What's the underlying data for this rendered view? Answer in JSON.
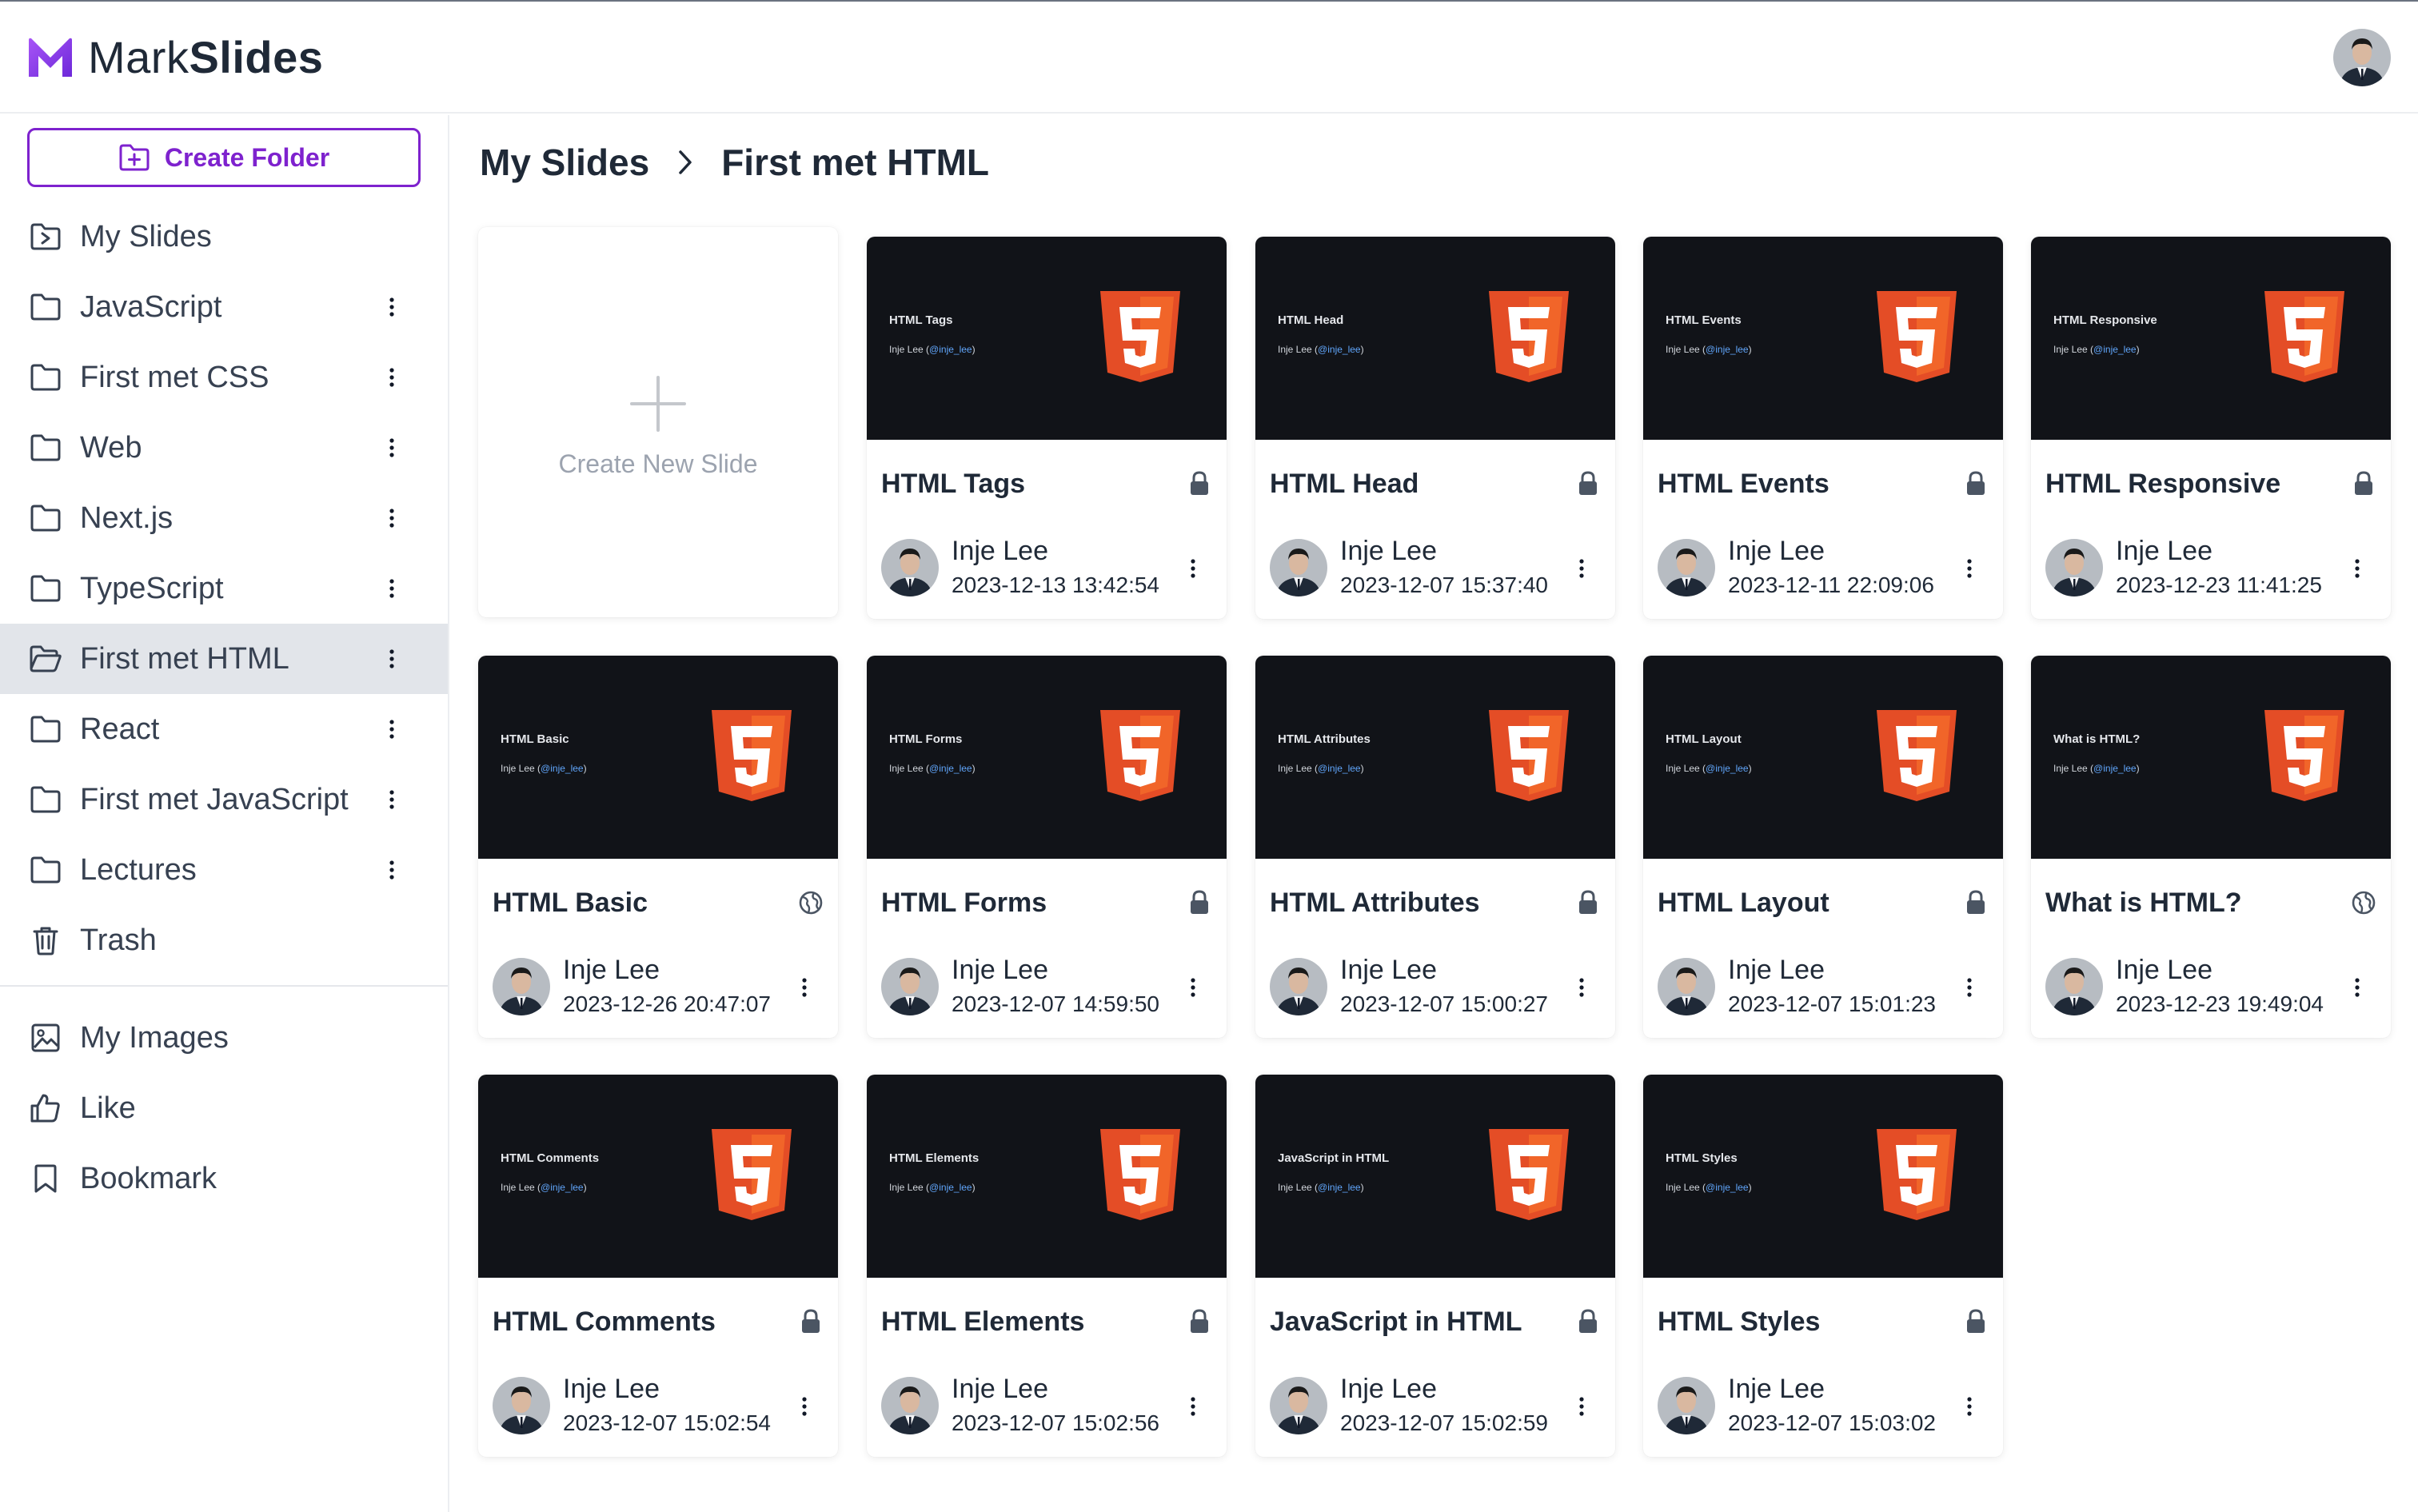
{
  "app": {
    "brand_light": "Mark",
    "brand_bold": "Slides",
    "accent": "#7e22ce"
  },
  "sidebar": {
    "create_folder_label": "Create Folder",
    "items": [
      {
        "label": "My Slides",
        "icon": "folder-user-icon",
        "menu": false
      },
      {
        "label": "JavaScript",
        "icon": "folder-icon",
        "menu": true
      },
      {
        "label": "First met CSS",
        "icon": "folder-icon",
        "menu": true
      },
      {
        "label": "Web",
        "icon": "folder-icon",
        "menu": true
      },
      {
        "label": "Next.js",
        "icon": "folder-icon",
        "menu": true
      },
      {
        "label": "TypeScript",
        "icon": "folder-icon",
        "menu": true
      },
      {
        "label": "First met HTML",
        "icon": "folder-open-icon",
        "menu": true,
        "active": true
      },
      {
        "label": "React",
        "icon": "folder-icon",
        "menu": true
      },
      {
        "label": "First met JavaScript",
        "icon": "folder-icon",
        "menu": true
      },
      {
        "label": "Lectures",
        "icon": "folder-icon",
        "menu": true
      },
      {
        "label": "Trash",
        "icon": "trash-icon",
        "menu": false
      }
    ],
    "secondary": [
      {
        "label": "My Images",
        "icon": "image-icon"
      },
      {
        "label": "Like",
        "icon": "thumbs-up-icon"
      },
      {
        "label": "Bookmark",
        "icon": "bookmark-icon"
      }
    ]
  },
  "breadcrumb": {
    "root": "My Slides",
    "current": "First met HTML"
  },
  "new_slide_label": "Create New Slide",
  "slides": [
    {
      "title": "HTML Tags",
      "thumb_title": "HTML Tags",
      "author": "Inje Lee",
      "date": "2023-12-13 13:42:54",
      "visibility": "lock-icon"
    },
    {
      "title": "HTML Head",
      "thumb_title": "HTML Head",
      "author": "Inje Lee",
      "date": "2023-12-07 15:37:40",
      "visibility": "lock-icon"
    },
    {
      "title": "HTML Events",
      "thumb_title": "HTML Events",
      "author": "Inje Lee",
      "date": "2023-12-11 22:09:06",
      "visibility": "lock-icon"
    },
    {
      "title": "HTML Responsive",
      "thumb_title": "HTML Responsive",
      "author": "Inje Lee",
      "date": "2023-12-23 11:41:25",
      "visibility": "lock-icon"
    },
    {
      "title": "HTML Basic",
      "thumb_title": "HTML Basic",
      "author": "Inje Lee",
      "date": "2023-12-26 20:47:07",
      "visibility": "globe-icon"
    },
    {
      "title": "HTML Forms",
      "thumb_title": "HTML Forms",
      "author": "Inje Lee",
      "date": "2023-12-07 14:59:50",
      "visibility": "lock-icon"
    },
    {
      "title": "HTML Attributes",
      "thumb_title": "HTML Attributes",
      "author": "Inje Lee",
      "date": "2023-12-07 15:00:27",
      "visibility": "lock-icon"
    },
    {
      "title": "HTML Layout",
      "thumb_title": "HTML Layout",
      "author": "Inje Lee",
      "date": "2023-12-07 15:01:23",
      "visibility": "lock-icon"
    },
    {
      "title": "What is HTML?",
      "thumb_title": "What is HTML?",
      "author": "Inje Lee",
      "date": "2023-12-23 19:49:04",
      "visibility": "globe-icon"
    },
    {
      "title": "HTML Comments",
      "thumb_title": "HTML Comments",
      "author": "Inje Lee",
      "date": "2023-12-07 15:02:54",
      "visibility": "lock-icon"
    },
    {
      "title": "HTML Elements",
      "thumb_title": "HTML Elements",
      "author": "Inje Lee",
      "date": "2023-12-07 15:02:56",
      "visibility": "lock-icon"
    },
    {
      "title": "JavaScript in HTML",
      "thumb_title": "JavaScript in HTML",
      "author": "Inje Lee",
      "date": "2023-12-07 15:02:59",
      "visibility": "lock-icon"
    },
    {
      "title": "HTML Styles",
      "thumb_title": "HTML Styles",
      "author": "Inje Lee",
      "date": "2023-12-07 15:03:02",
      "visibility": "lock-icon"
    }
  ],
  "thumb_author_prefix": "Inje Lee (",
  "thumb_author_handle": "@inje_lee",
  "thumb_author_suffix": ")"
}
